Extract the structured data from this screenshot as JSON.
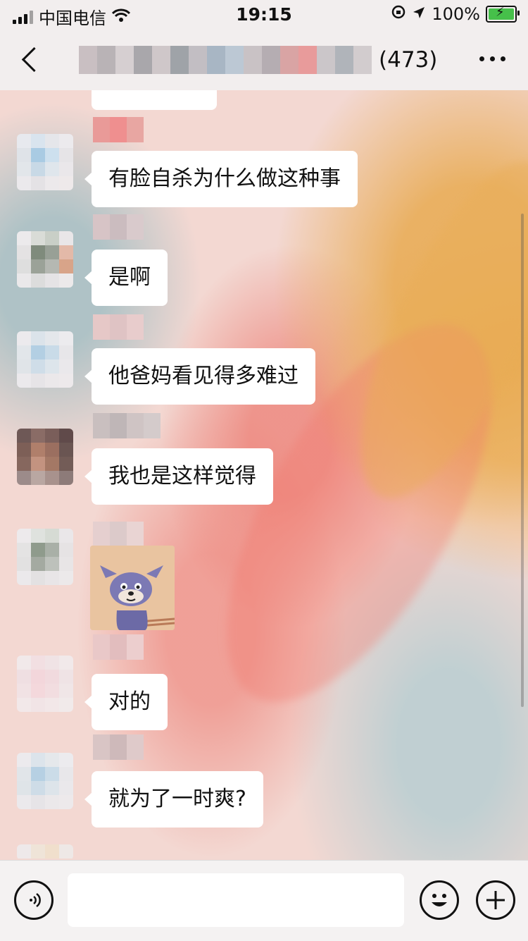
{
  "status_bar": {
    "carrier": "中国电信",
    "time": "19:15",
    "battery": "100%"
  },
  "nav": {
    "member_count": "(473)"
  },
  "messages": [
    {
      "type": "text",
      "text": "有脸自杀为什么做这种事"
    },
    {
      "type": "text",
      "text": "是啊"
    },
    {
      "type": "text",
      "text": "他爸妈看见得多难过"
    },
    {
      "type": "text",
      "text": "我也是这样觉得"
    },
    {
      "type": "sticker",
      "sticker": "cat-sticker"
    },
    {
      "type": "text",
      "text": "对的"
    },
    {
      "type": "text",
      "text": "就为了一时爽?"
    }
  ],
  "icons": {
    "voice": "voice-input-icon",
    "emoji": "emoji-icon",
    "plus": "plus-icon",
    "back": "back-arrow-icon",
    "more": "more-icon"
  },
  "colors": {
    "bubble": "#ffffff",
    "battery_fill": "#46c04a",
    "bar_bg": "#f2eeee"
  }
}
